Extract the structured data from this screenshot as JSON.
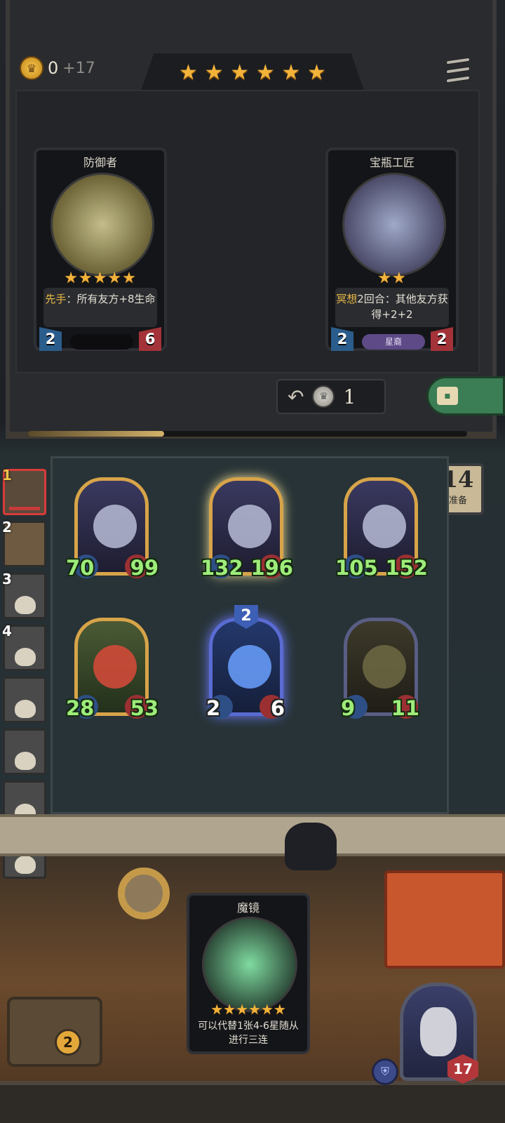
{
  "top": {
    "gold": "0",
    "gold_income": "+17",
    "tier_stars": [
      "★",
      "★",
      "★",
      "★",
      "★",
      "★"
    ]
  },
  "shop": {
    "cards": [
      {
        "name": "防御者",
        "stars": "★★★★★",
        "desc_highlight": "先手",
        "desc_text": "：所有友方+8生命",
        "attack": "2",
        "health": "6",
        "tribe": ""
      },
      {
        "name": "宝瓶工匠",
        "stars": "★★",
        "desc_highlight": "冥想",
        "desc_text": "2回合：其他友方获得+2+2",
        "attack": "2",
        "health": "2",
        "tribe": "星裔"
      }
    ],
    "refresh_cost": "1",
    "progress": 0.31
  },
  "prep": {
    "count": "14",
    "label": "准备"
  },
  "ranking": {
    "players": [
      {
        "place": "1",
        "me": true
      },
      {
        "place": "2",
        "me": false
      },
      {
        "place": "3",
        "me": false
      },
      {
        "place": "4",
        "me": false
      },
      {
        "place": "",
        "me": false
      },
      {
        "place": "",
        "me": false
      },
      {
        "place": "",
        "me": false
      },
      {
        "place": "",
        "me": false
      }
    ]
  },
  "board": {
    "units": [
      {
        "attack": "70",
        "health": "99"
      },
      {
        "attack": "132",
        "health": "196"
      },
      {
        "attack": "105",
        "health": "152"
      },
      {
        "attack": "28",
        "health": "53"
      },
      {
        "attack": "2",
        "health": "6",
        "tier": "2"
      },
      {
        "attack": "9",
        "health": "11"
      }
    ]
  },
  "hand": {
    "card": {
      "name": "魔镜",
      "stars": "★★★★★★",
      "desc": "可以代替1张4-6星随从进行三连"
    }
  },
  "treasure": {
    "count": "2"
  },
  "hero": {
    "health": "17"
  }
}
